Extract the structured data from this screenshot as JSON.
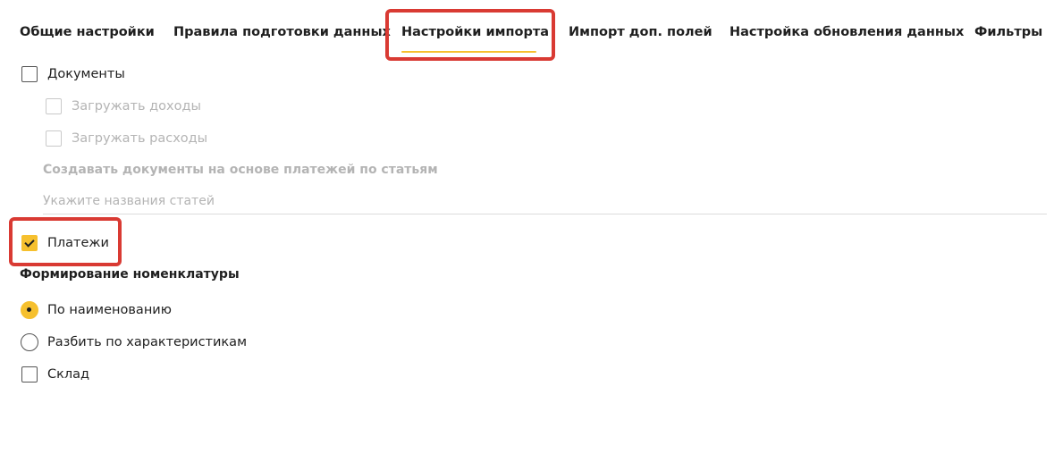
{
  "tabs": [
    {
      "label": "Общие настройки"
    },
    {
      "label": "Правила подготовки данных"
    },
    {
      "label": "Настройки импорта"
    },
    {
      "label": "Импорт доп. полей"
    },
    {
      "label": "Настройка обновления данных"
    },
    {
      "label": "Фильтры"
    }
  ],
  "active_tab": "Настройки импорта",
  "documents": {
    "label": "Документы",
    "checked": false,
    "load_income": {
      "label": "Загружать доходы",
      "disabled": true,
      "checked": false
    },
    "load_expenses": {
      "label": "Загружать расходы",
      "disabled": true,
      "checked": false
    },
    "create_docs_title": "Создавать документы на основе платежей по статьям",
    "articles_placeholder": "Укажите названия статей"
  },
  "payments": {
    "label": "Платежи",
    "checked": true
  },
  "nomenclature": {
    "title": "Формирование номенклатуры",
    "options": [
      {
        "label": "По наименованию",
        "selected": true
      },
      {
        "label": "Разбить по характеристикам",
        "selected": false
      }
    ]
  },
  "warehouse": {
    "label": "Склад",
    "checked": false
  },
  "colors": {
    "accent": "#f6c02e",
    "highlight": "#d93a33",
    "disabled_text": "#b4b4b4"
  }
}
